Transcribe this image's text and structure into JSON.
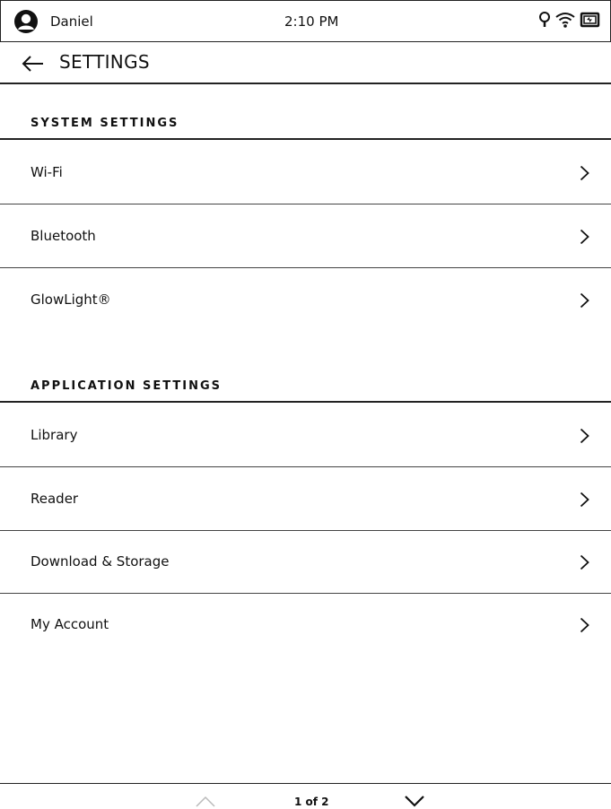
{
  "status_bar": {
    "user_name": "Daniel",
    "time": "2:10 PM",
    "icons": [
      "avatar-icon",
      "glowlight-bulb-icon",
      "wifi-icon",
      "battery-charging-icon"
    ]
  },
  "header": {
    "back_icon": "back-arrow-icon",
    "title": "SETTINGS"
  },
  "sections": [
    {
      "title": "SYSTEM SETTINGS",
      "items": [
        {
          "label": "Wi-Fi",
          "icon": "chevron-right-icon"
        },
        {
          "label": "Bluetooth",
          "icon": "chevron-right-icon"
        },
        {
          "label": "GlowLight®",
          "icon": "chevron-right-icon"
        }
      ]
    },
    {
      "title": "APPLICATION SETTINGS",
      "items": [
        {
          "label": "Library",
          "icon": "chevron-right-icon"
        },
        {
          "label": "Reader",
          "icon": "chevron-right-icon"
        },
        {
          "label": "Download & Storage",
          "icon": "chevron-right-icon"
        },
        {
          "label": "My Account",
          "icon": "chevron-right-icon"
        }
      ]
    }
  ],
  "footer": {
    "page_indicator": "1 of 2",
    "prev_icon": "chevron-up-icon",
    "next_icon": "chevron-down-icon"
  },
  "colors": {
    "background": "#ffffff",
    "text": "#111111",
    "divider": "#222222",
    "disabled": "#bbbbbb"
  }
}
